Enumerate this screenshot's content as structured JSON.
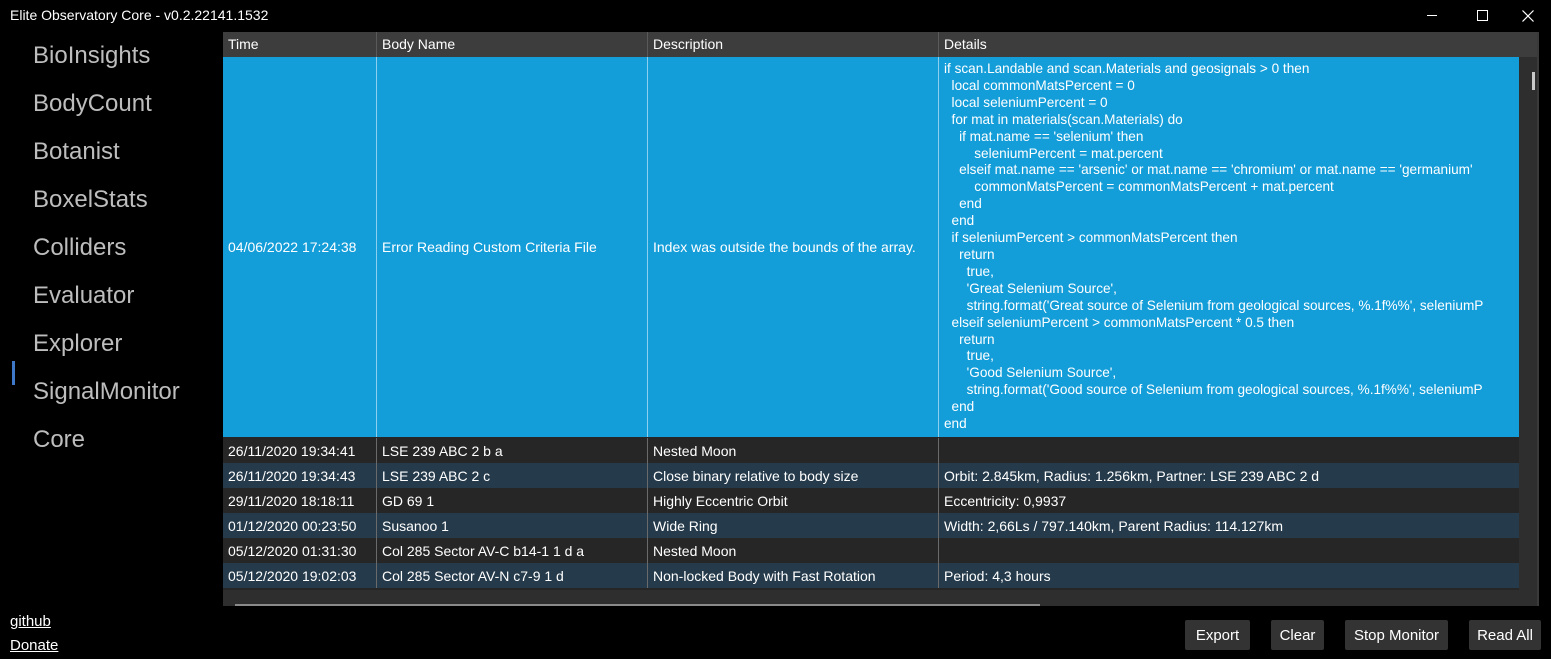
{
  "window": {
    "title": "Elite Observatory Core - v0.2.22141.1532"
  },
  "sidebar": {
    "items": [
      {
        "label": "BioInsights"
      },
      {
        "label": "BodyCount"
      },
      {
        "label": "Botanist"
      },
      {
        "label": "BoxelStats"
      },
      {
        "label": "Colliders"
      },
      {
        "label": "Evaluator"
      },
      {
        "label": "Explorer",
        "selected": true
      },
      {
        "label": "SignalMonitor"
      },
      {
        "label": "Core"
      }
    ],
    "links": {
      "github": "github",
      "donate": "Donate"
    }
  },
  "grid": {
    "columns": [
      "Time",
      "Body Name",
      "Description",
      "Details"
    ],
    "selected_row": {
      "time": "04/06/2022 17:24:38",
      "body": "Error Reading Custom Criteria File",
      "description": "Index was outside the bounds of the array.",
      "details": "if scan.Landable and scan.Materials and geosignals > 0 then\n  local commonMatsPercent = 0\n  local seleniumPercent = 0\n  for mat in materials(scan.Materials) do\n    if mat.name == 'selenium' then\n        seleniumPercent = mat.percent\n    elseif mat.name == 'arsenic' or mat.name == 'chromium' or mat.name == 'germanium'\n        commonMatsPercent = commonMatsPercent + mat.percent\n    end\n  end\n  if seleniumPercent > commonMatsPercent then\n    return\n      true,\n      'Great Selenium Source',\n      string.format('Great source of Selenium from geological sources, %.1f%%', seleniumP\n  elseif seleniumPercent > commonMatsPercent * 0.5 then\n    return\n      true,\n      'Good Selenium Source',\n      string.format('Good source of Selenium from geological sources, %.1f%%', seleniumP\n  end\nend"
    },
    "rows": [
      {
        "time": "26/11/2020 19:34:41",
        "body": "LSE 239 ABC 2 b a",
        "description": "Nested Moon",
        "details": ""
      },
      {
        "time": "26/11/2020 19:34:43",
        "body": "LSE 239 ABC 2 c",
        "description": "Close binary relative to body size",
        "details": "Orbit: 2.845km, Radius: 1.256km, Partner: LSE 239 ABC 2 d"
      },
      {
        "time": "29/11/2020 18:18:11",
        "body": "GD 69 1",
        "description": "Highly Eccentric Orbit",
        "details": "Eccentricity: 0,9937"
      },
      {
        "time": "01/12/2020 00:23:50",
        "body": "Susanoo 1",
        "description": "Wide Ring",
        "details": "Width: 2,66Ls / 797.140km, Parent Radius: 114.127km"
      },
      {
        "time": "05/12/2020 01:31:30",
        "body": "Col 285 Sector AV-C b14-1 1 d a",
        "description": "Nested Moon",
        "details": ""
      },
      {
        "time": "05/12/2020 19:02:03",
        "body": "Col 285 Sector AV-N c7-9 1 d",
        "description": "Non-locked Body with Fast Rotation",
        "details": "Period: 4,3 hours"
      }
    ]
  },
  "buttons": {
    "export": "Export",
    "clear": "Clear",
    "stop_monitor": "Stop Monitor",
    "read_all": "Read All"
  },
  "colors": {
    "selected_row": "#139dd9",
    "alt_row": "#253a4a",
    "row": "#262626",
    "nav_indicator": "#3f78c9"
  }
}
